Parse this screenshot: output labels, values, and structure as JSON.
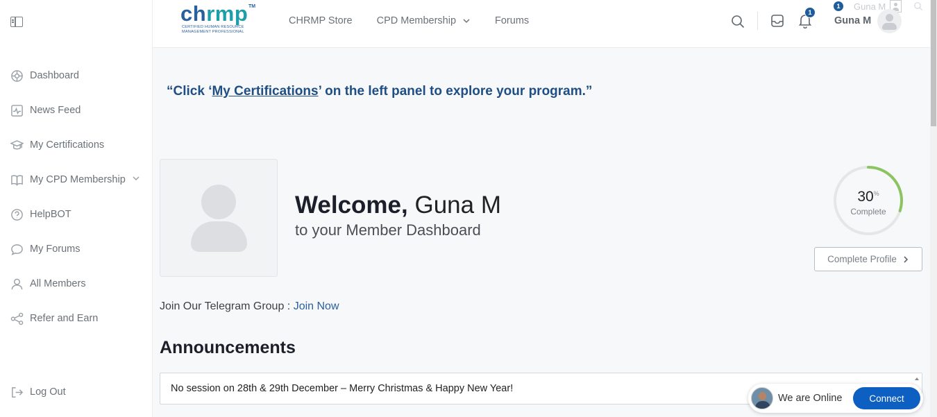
{
  "sidebar": {
    "items": [
      {
        "label": "Dashboard",
        "icon": "dashboard-icon"
      },
      {
        "label": "News Feed",
        "icon": "activity-icon"
      },
      {
        "label": "My Certifications",
        "icon": "graduation-cap-icon"
      },
      {
        "label": "My CPD Membership",
        "icon": "book-icon"
      },
      {
        "label": "HelpBOT",
        "icon": "help-circle-icon"
      },
      {
        "label": "My Forums",
        "icon": "chat-icon"
      },
      {
        "label": "All Members",
        "icon": "user-icon"
      },
      {
        "label": "Refer and Earn",
        "icon": "share-icon"
      }
    ],
    "logout": "Log Out"
  },
  "header": {
    "logo": {
      "text_a": "ch",
      "text_b": "rmp",
      "tm": "TM",
      "tagline_1": "CERTIFIED HUMAN RESOURCE",
      "tagline_2": "MANAGEMENT PROFESSIONAL"
    },
    "nav": [
      "CHRMP Store",
      "CPD Membership",
      "Forums"
    ],
    "notification_count": "1",
    "profile_badge": "1",
    "username": "Guna M",
    "ghost_username": "Guna M"
  },
  "main": {
    "quote_prefix": "“Click ‘",
    "quote_link": "My Certifications",
    "quote_suffix": "’ on the left panel to explore your program.”",
    "welcome_bold": "Welcome,",
    "welcome_name": "Guna M",
    "subtitle": "to your Member Dashboard",
    "progress": {
      "value": "30",
      "unit": "%",
      "label": "Complete",
      "fraction": 0.3
    },
    "complete_profile": "Complete Profile",
    "telegram_text": "Join Our Telegram Group : ",
    "telegram_link": "Join Now",
    "announcements_title": "Announcements",
    "announcement": "No session on 28th & 29th December – Merry Christmas & Happy New Year!"
  },
  "chat": {
    "status": "We are Online",
    "button": "Connect"
  },
  "colors": {
    "brand_blue": "#2a5f9e",
    "brand_teal": "#1c9fa8",
    "progress_green": "#8dc462",
    "connect_blue": "#0d5fc2"
  }
}
